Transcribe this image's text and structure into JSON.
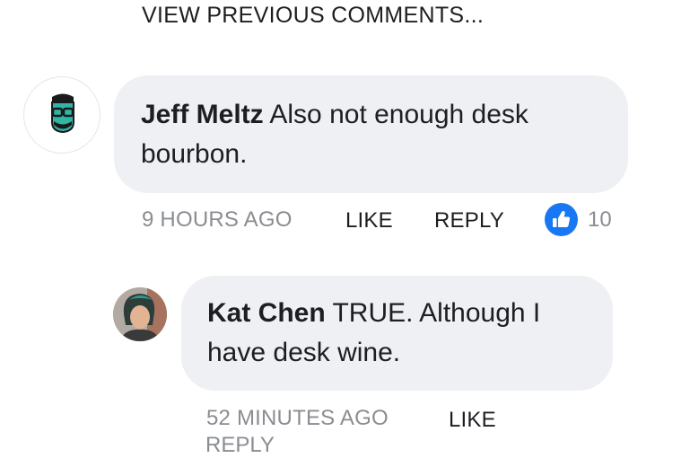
{
  "view_previous": "VIEW PREVIOUS COMMENTS...",
  "comments": [
    {
      "author": "Jeff Meltz",
      "text": "Also not enough desk bourbon.",
      "time": "9 HOURS AGO",
      "like_label": "LIKE",
      "reply_label": "REPLY",
      "like_count": "10",
      "avatar_icon": "cartoon-face-glasses-icon"
    },
    {
      "author": "Kat Chen",
      "text": "TRUE. Although I have desk wine.",
      "time": "52 MINUTES AGO",
      "like_label": "LIKE",
      "reply_label_partial": "REPLY",
      "avatar_icon": "user-photo-avatar"
    }
  ],
  "colors": {
    "accent": "#1877f2",
    "bubble": "#eef0f3",
    "muted": "#8a8d91",
    "text": "#1c1e21"
  }
}
